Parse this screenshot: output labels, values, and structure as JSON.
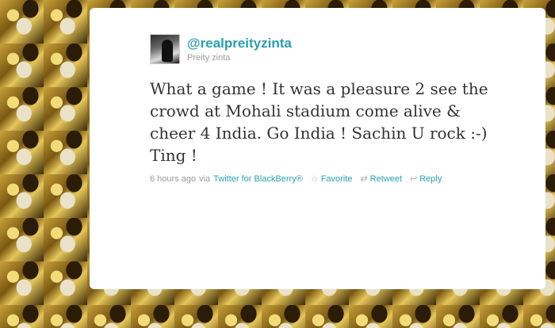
{
  "tweet": {
    "handle": "@realpreityzinta",
    "fullname": "Preity zinta",
    "text": "What a game ! It was a pleasure 2 see the crowd at Mohali stadium come alive & cheer 4 India. Go India ! Sachin U rock :-) Ting !",
    "time": "6 hours ago",
    "via_prefix": "via",
    "source": "Twitter for BlackBerry®",
    "actions": {
      "favorite": "Favorite",
      "retweet": "Retweet",
      "reply": "Reply"
    }
  },
  "icons": {
    "favorite": "star-icon",
    "retweet": "retweet-icon",
    "reply": "reply-arrow-icon"
  },
  "colors": {
    "link": "#2a9fb1",
    "meta": "#999999",
    "text": "#333333",
    "card": "#ffffff"
  }
}
